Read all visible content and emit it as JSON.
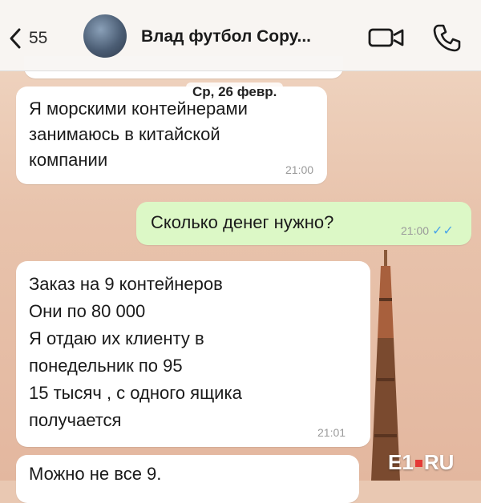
{
  "header": {
    "back_count": "55",
    "title": "Влад футбол Сору..."
  },
  "date_label": "Ср, 26 февр.",
  "messages": [
    {
      "text": "Я морскими контейнерами\nзанимаюсь в китайской\nкомпании",
      "time": "21:00",
      "direction": "incoming"
    },
    {
      "text": "Сколько денег нужно?",
      "time": "21:00",
      "direction": "outgoing",
      "status": "read"
    },
    {
      "text": "Заказ на 9 контейнеров\nОни по 80 000\nЯ отдаю их клиенту в\nпонедельник по 95\n15 тысяч , с одного ящика\nполучается",
      "time": "21:01",
      "direction": "incoming"
    },
    {
      "text": "Можно не все 9.",
      "time": "",
      "direction": "incoming"
    }
  ],
  "watermark": {
    "left": "E1",
    "right": "RU"
  },
  "colors": {
    "outgoing_bubble": "#dcf8c6",
    "incoming_bubble": "#ffffff",
    "read_ticks": "#4aa5e8"
  }
}
